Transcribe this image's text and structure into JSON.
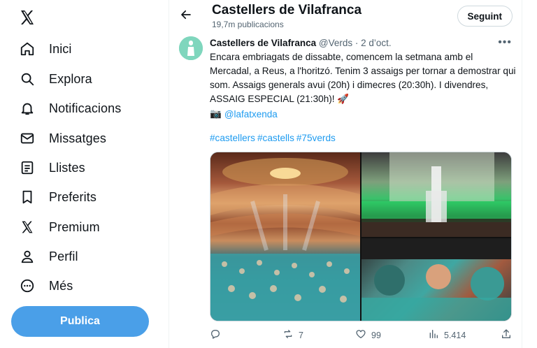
{
  "nav": {
    "items": [
      {
        "label": "Inici",
        "icon": "home-icon"
      },
      {
        "label": "Explora",
        "icon": "search-icon"
      },
      {
        "label": "Notificacions",
        "icon": "bell-icon"
      },
      {
        "label": "Missatges",
        "icon": "envelope-icon"
      },
      {
        "label": "Llistes",
        "icon": "list-icon"
      },
      {
        "label": "Preferits",
        "icon": "bookmark-icon"
      },
      {
        "label": "Premium",
        "icon": "x-logo-icon"
      },
      {
        "label": "Perfil",
        "icon": "person-icon"
      },
      {
        "label": "Més",
        "icon": "more-circle-icon"
      }
    ],
    "post_label": "Publica"
  },
  "header": {
    "title": "Castellers de Vilafranca",
    "subtitle": "19,7m publicacions",
    "follow_label": "Seguint"
  },
  "tweet": {
    "name": "Castellers de Vilafranca",
    "handle_date": "@Verds · 2 d’oct.",
    "text": "Encara embriagats de dissabte, comencem la setmana amb el Mercadal, a Reus, a l'horitzó. Tenim 3 assaigs per tornar a demostrar qui som. Assaigs generals avui (20h) i dimecres (20:30h). I divendres, ASSAIG ESPECIAL (21:30h)! 🚀",
    "camera_emoji": "📷",
    "mention": "@lafatxenda",
    "hashtags": [
      "#castellers",
      "#castells",
      "#75verds"
    ],
    "stats": {
      "replies": "",
      "retweets": "7",
      "likes": "99",
      "views": "5.414"
    }
  },
  "colors": {
    "accent": "#1d9bf0",
    "post_button": "#4a9fe8",
    "muted": "#536471"
  }
}
